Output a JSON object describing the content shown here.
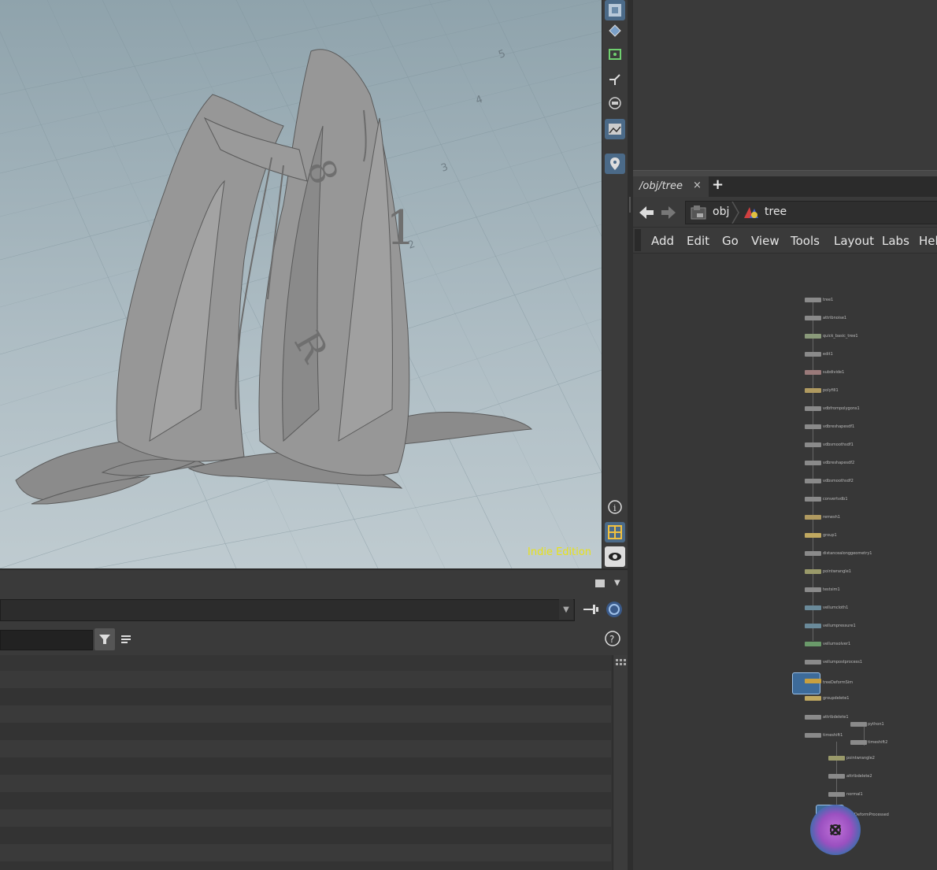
{
  "viewport": {
    "edition_label": "Indie Edition",
    "texture_text": [
      "8",
      "8",
      "1",
      "1",
      "R",
      "2",
      "3",
      "4",
      "5"
    ]
  },
  "viewport_toolbar": {
    "icons": [
      "display-options-icon",
      "snap-icon",
      "uv-icon",
      "handle-icon",
      "ghost-icon",
      "background-image-icon",
      "pin-icon",
      "info-icon",
      "grid-icon",
      "visibility-icon"
    ]
  },
  "network_editor": {
    "tab_title": "/obj/tree",
    "tab_close": "×",
    "tab_add": "+",
    "path": {
      "root": "obj",
      "node": "tree"
    },
    "menu": [
      "Add",
      "Edit",
      "Go",
      "View",
      "Tools",
      "Layout",
      "Labs",
      "Hel"
    ],
    "nodes": [
      "tree1",
      "attribnoise1",
      "quick_basic_tree1",
      "edit1",
      "subdivide1",
      "polyfill1",
      "vdbfrompolygons1",
      "vdbreshapesdf1",
      "vdbsmoothsdf1",
      "vdbreshapesdf2",
      "vdbsmoothsdf2",
      "convertvdb1",
      "remesh1",
      "group1",
      "distancealonggeometry1",
      "pointwrangle1",
      "testsim1",
      "vellumcloth1",
      "vellumpressure1",
      "vellumsolver1",
      "vellumpostprocess1",
      "treeDeformSim",
      "groupdelete1",
      "attribdelete1",
      "timeshift1",
      "python1",
      "timeshift2",
      "pointwrangle2",
      "attribdelete2",
      "normal1",
      "treeDeformProcessed"
    ]
  },
  "colors": {
    "accent_blue": "#4b6a88",
    "edition_yellow": "#e8e21a",
    "panel_bg": "#3a3a3a"
  }
}
